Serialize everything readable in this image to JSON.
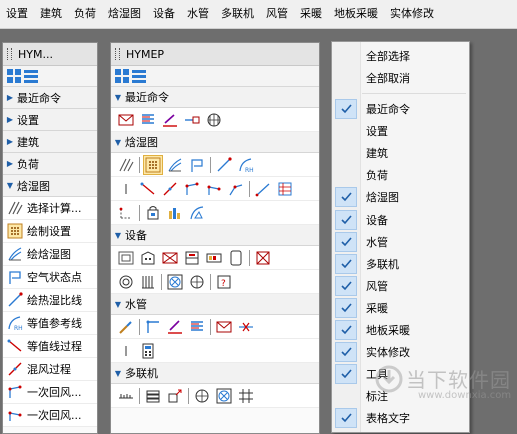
{
  "menubar": [
    "设置",
    "建筑",
    "负荷",
    "焓湿图",
    "设备",
    "水管",
    "多联机",
    "风管",
    "采暖",
    "地板采暖",
    "实体修改"
  ],
  "left_panel": {
    "title": "HYM...",
    "categories": [
      "最近命令",
      "设置",
      "建筑",
      "负荷"
    ],
    "expanded": "焓湿图",
    "commands": [
      "选择计算...",
      "绘制设置",
      "绘焓湿图",
      "空气状态点",
      "绘热湿比线",
      "等值参考线",
      "等值线过程",
      "混风过程",
      "一次回风...",
      "一次回风..."
    ]
  },
  "right_panel": {
    "title": "HYMEP",
    "sections": [
      "最近命令",
      "焓湿图",
      "设备",
      "水管",
      "多联机"
    ]
  },
  "context_menu": {
    "top_items": [
      "全部选择",
      "全部取消"
    ],
    "items": [
      {
        "label": "最近命令",
        "checked": true
      },
      {
        "label": "设置",
        "checked": false
      },
      {
        "label": "建筑",
        "checked": false
      },
      {
        "label": "负荷",
        "checked": false
      },
      {
        "label": "焓湿图",
        "checked": true
      },
      {
        "label": "设备",
        "checked": true
      },
      {
        "label": "水管",
        "checked": true
      },
      {
        "label": "多联机",
        "checked": true
      },
      {
        "label": "风管",
        "checked": true
      },
      {
        "label": "采暖",
        "checked": true
      },
      {
        "label": "地板采暖",
        "checked": true
      },
      {
        "label": "实体修改",
        "checked": true
      },
      {
        "label": "工具",
        "checked": true
      },
      {
        "label": "标注",
        "checked": false
      },
      {
        "label": "表格文字",
        "checked": true
      }
    ]
  },
  "watermark": {
    "brand": "当下软件园",
    "url": "www.downxia.com"
  },
  "colors": {
    "check": "#1f5fa8",
    "check_bg": "#cfe3f7",
    "accent": "#1f5fa8",
    "selected_icon_bg": "#fde8a8"
  }
}
